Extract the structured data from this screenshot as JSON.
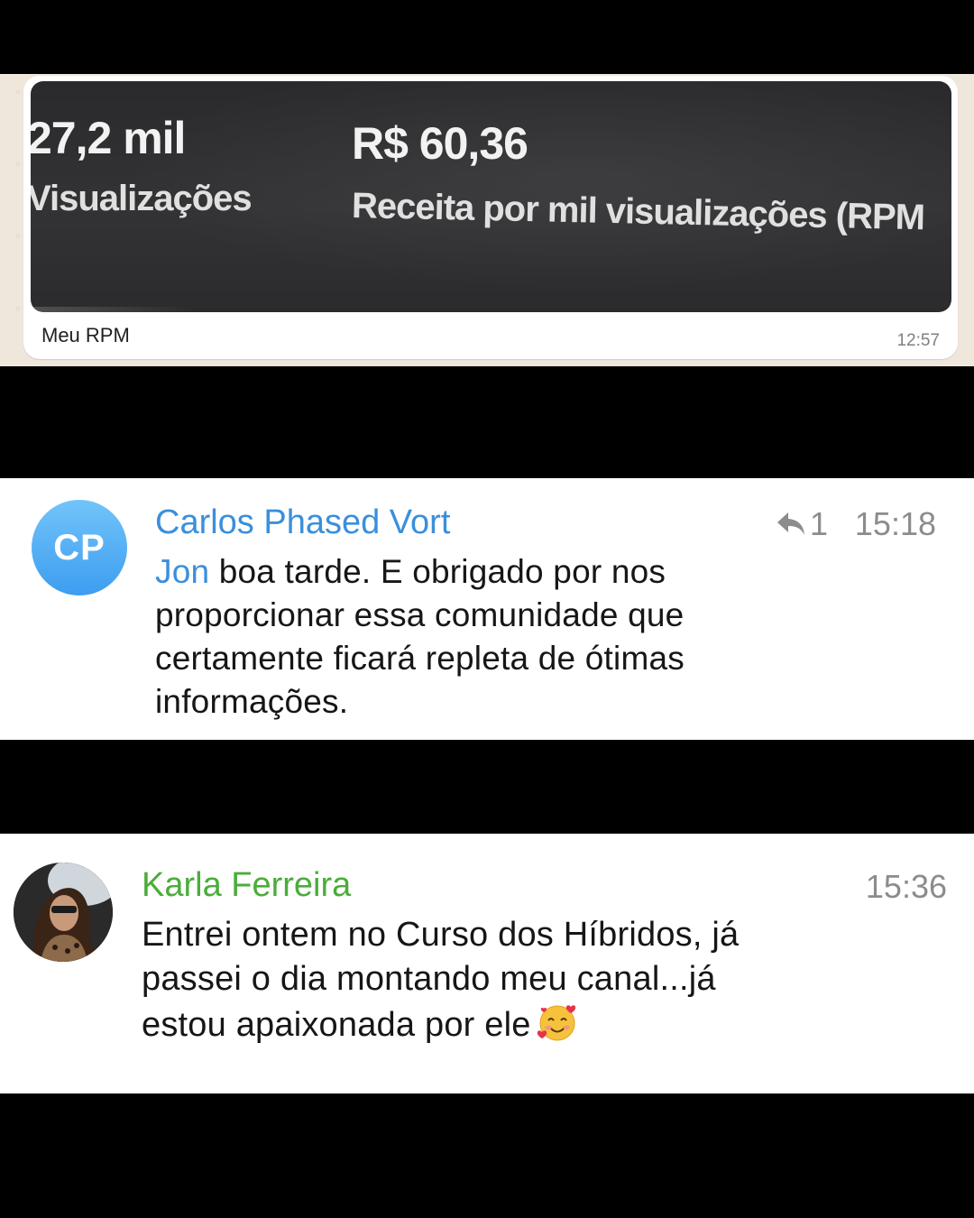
{
  "whatsapp_message": {
    "photo": {
      "views_value": "27,2 mil",
      "views_label": "Visualizações",
      "rpm_value": "R$ 60,36",
      "rpm_label": "Receita por mil visualizações (RPM"
    },
    "caption": "Meu RPM",
    "time": "12:57"
  },
  "telegram_message_1": {
    "avatar_initials": "CP",
    "sender": "Carlos Phased Vort",
    "reply_count": "1",
    "time": "15:18",
    "mention": "Jon",
    "text": " boa tarde. E obrigado por nos proporcionar essa comunidade que certamente ficará repleta de ótimas informações."
  },
  "telegram_message_2": {
    "sender": "Karla Ferreira",
    "time": "15:36",
    "text": "Entrei ontem no Curso dos Híbridos, já passei o dia montando meu canal...já estou apaixonada por ele",
    "emoji": "smiling-face-with-hearts"
  },
  "colors": {
    "telegram_link_blue": "#3a8fdc",
    "telegram_name_green": "#4aad3a",
    "whatsapp_wallpaper": "#efe7dc"
  }
}
